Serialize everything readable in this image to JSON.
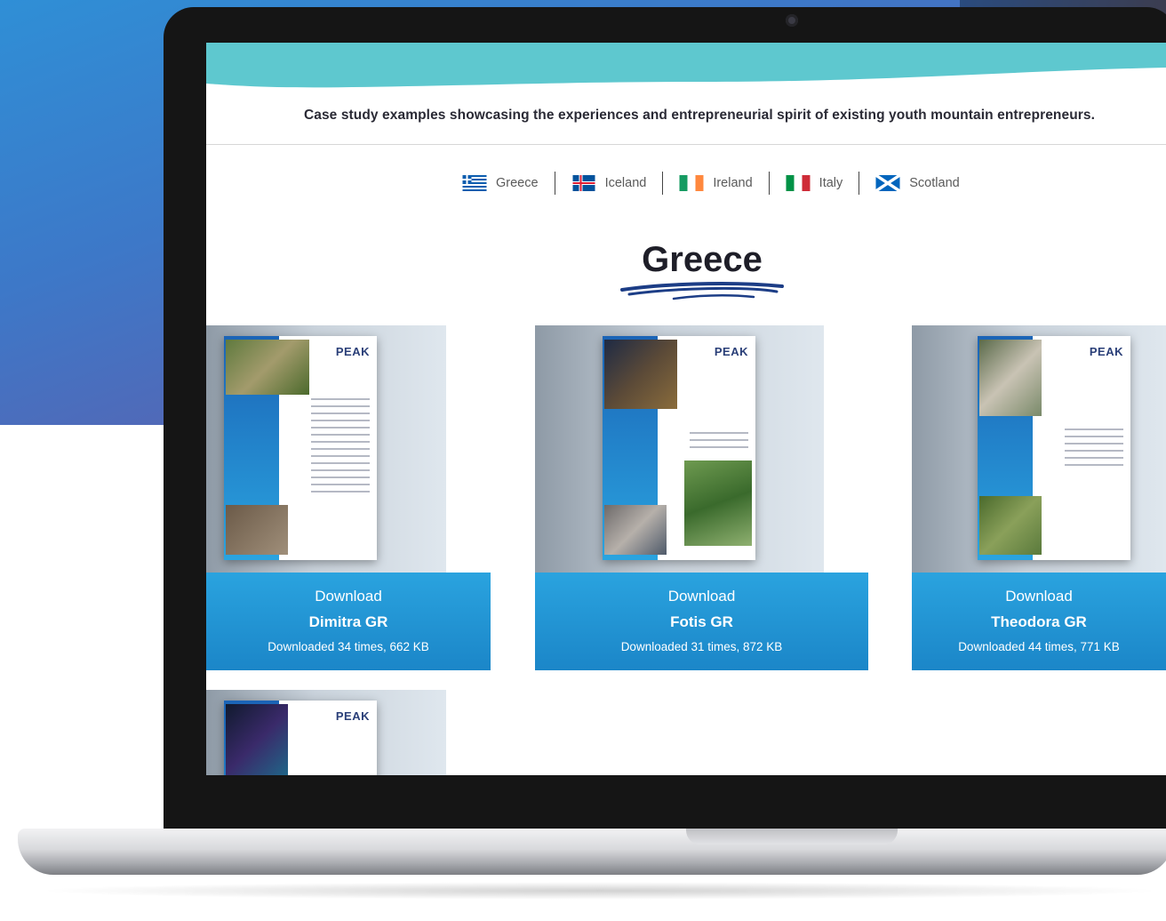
{
  "page": {
    "tagline": "Case study examples showcasing the experiences and entrepreneurial spirit of existing youth mountain entrepreneurs.",
    "heading": "Greece"
  },
  "countries": [
    {
      "label": "Greece",
      "flag": "greece-flag-icon"
    },
    {
      "label": "Iceland",
      "flag": "iceland-flag-icon"
    },
    {
      "label": "Ireland",
      "flag": "ireland-flag-icon"
    },
    {
      "label": "Italy",
      "flag": "italy-flag-icon"
    },
    {
      "label": "Scotland",
      "flag": "scotland-flag-icon"
    }
  ],
  "logo_text": "PEAK",
  "cards": [
    {
      "download_label": "Download",
      "name": "Dimitra GR",
      "meta": "Downloaded 34 times, 662 KB"
    },
    {
      "download_label": "Download",
      "name": "Fotis GR",
      "meta": "Downloaded 31 times, 872 KB"
    },
    {
      "download_label": "Download",
      "name": "Theodora GR",
      "meta": "Downloaded 44 times, 771 KB"
    },
    {
      "download_label": "",
      "name": "",
      "meta": ""
    }
  ],
  "colors": {
    "accent_teal": "#5ec8cf",
    "button_blue": "#1f92d2",
    "backdrop_gradient_start": "#2f8fd6",
    "backdrop_gradient_end": "#6a57a5"
  }
}
